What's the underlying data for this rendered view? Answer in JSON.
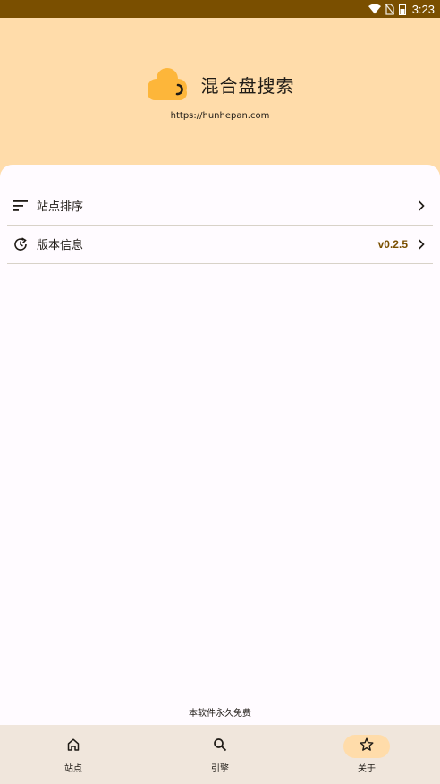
{
  "status_bar": {
    "time": "3:23",
    "icons": [
      "wifi-icon",
      "no-sim-icon",
      "battery-icon"
    ]
  },
  "header": {
    "app_name": "混合盘搜索",
    "url": "https://hunhepan.com",
    "logo_icon": "cloud-logo-icon"
  },
  "menu": {
    "items": [
      {
        "label": "站点排序",
        "icon": "sort-icon",
        "value": ""
      },
      {
        "label": "版本信息",
        "icon": "update-icon",
        "value": "v0.2.5"
      }
    ]
  },
  "footer_note": "本软件永久免费",
  "bottom_nav": {
    "items": [
      {
        "label": "站点",
        "icon": "home-icon",
        "active": false
      },
      {
        "label": "引擎",
        "icon": "search-icon",
        "active": false
      },
      {
        "label": "关于",
        "icon": "star-icon",
        "active": true
      }
    ]
  },
  "colors": {
    "status_bar": "#7a4f00",
    "header_bg": "#ffdcaa",
    "logo": "#fdb63a",
    "accent_text": "#7a4f00",
    "sheet_bg": "#fffbff",
    "nav_bg": "#f0e6dc",
    "active_pill": "#ffdcaa"
  }
}
